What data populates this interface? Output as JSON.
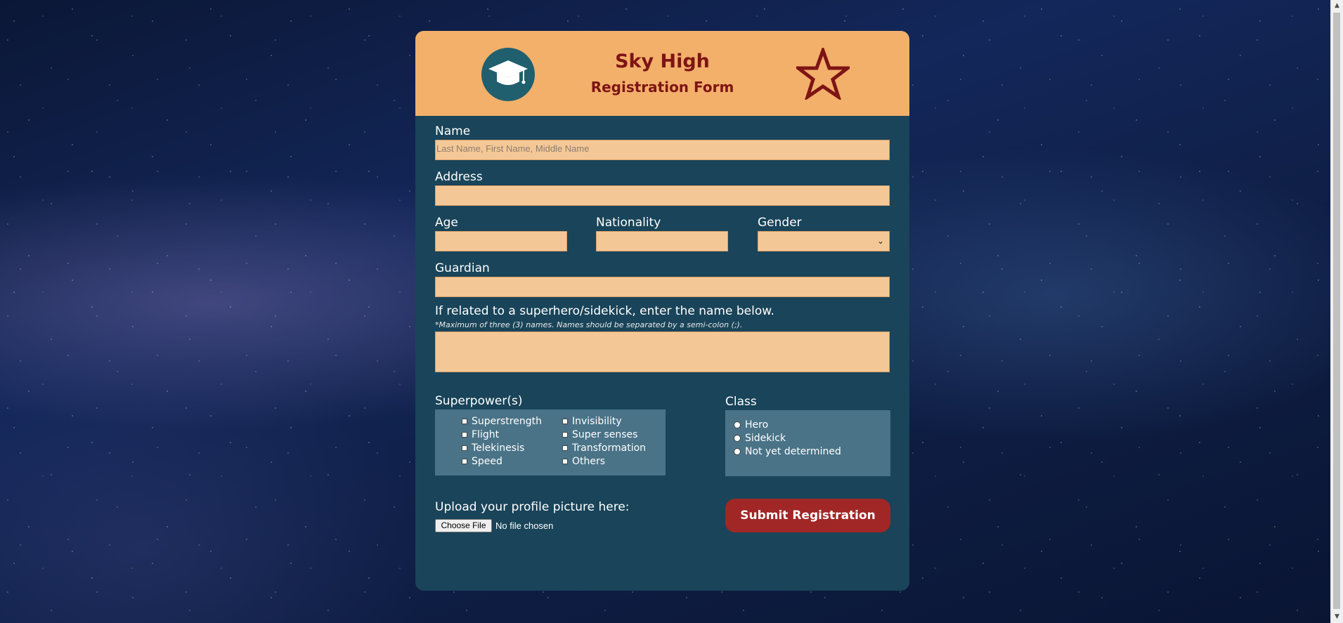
{
  "header": {
    "title": "Sky High",
    "subtitle": "Registration Form",
    "logo_icon": "graduation-cap-icon",
    "badge_icon": "star-icon"
  },
  "form": {
    "name_label": "Name",
    "name_placeholder": "Last Name, First Name, Middle Name",
    "address_label": "Address",
    "age_label": "Age",
    "nationality_label": "Nationality",
    "gender_label": "Gender",
    "guardian_label": "Guardian",
    "related_label": "If related to a superhero/sidekick, enter the name below.",
    "related_note": "*Maximum of three (3) names. Names should be separated by a semi-colon (;).",
    "superpowers_label": "Superpower(s)",
    "superpowers": [
      "Superstrength",
      "Flight",
      "Telekinesis",
      "Speed",
      "Invisibility",
      "Super senses",
      "Transformation",
      "Others"
    ],
    "class_label": "Class",
    "classes": [
      "Hero",
      "Sidekick",
      "Not yet determined"
    ],
    "upload_label": "Upload your profile picture here:",
    "file_button": "Choose File",
    "file_status": "No file chosen",
    "submit_label": "Submit Registration"
  },
  "colors": {
    "header_bg": "#f2b06b",
    "card_bg": "#194459",
    "title": "#7e1414",
    "field_bg": "#f4c896",
    "submit_bg": "#a12626"
  }
}
